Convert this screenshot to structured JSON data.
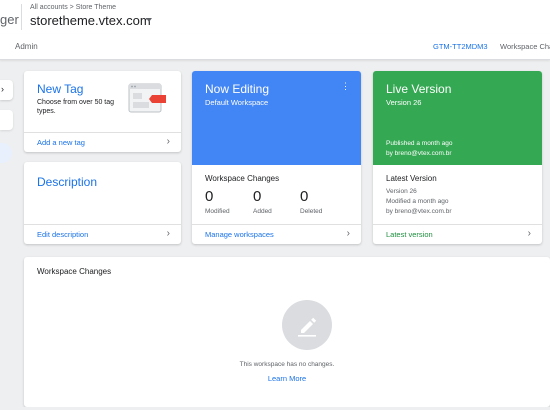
{
  "header": {
    "app_fragment": "ger",
    "breadcrumb": "All accounts > Store Theme",
    "container_name": "storetheme.vtex.com"
  },
  "nav": {
    "admin": "Admin",
    "container_id": "GTM-TT2MDM3",
    "workspace_changes": "Workspace Changes"
  },
  "new_tag": {
    "title": "New Tag",
    "description": "Choose from over 50 tag types.",
    "link": "Add a new tag"
  },
  "description_card": {
    "title": "Description",
    "link": "Edit description"
  },
  "now_editing": {
    "title": "Now Editing",
    "workspace": "Default Workspace",
    "changes_label": "Workspace Changes",
    "stats": [
      {
        "value": "0",
        "label": "Modified"
      },
      {
        "value": "0",
        "label": "Added"
      },
      {
        "value": "0",
        "label": "Deleted"
      }
    ],
    "link": "Manage workspaces"
  },
  "live_version": {
    "title": "Live Version",
    "version": "Version 26",
    "published": "Published a month ago",
    "published_by": "by breno@vtex.com.br",
    "latest_label": "Latest Version",
    "latest_version": "Version 26",
    "latest_modified": "Modified a month ago",
    "latest_by": "by breno@vtex.com.br",
    "link": "Latest version"
  },
  "changes_panel": {
    "title": "Workspace Changes",
    "empty_text": "This workspace has no changes.",
    "learn_more": "Learn More"
  },
  "colors": {
    "accent": "#1a73e8",
    "editing": "#4285f4",
    "live": "#34a853",
    "tag_red": "#ea4335"
  },
  "icons": {
    "caret": "chevron-down-icon",
    "card_chevron": "chevron-right-icon",
    "more": "more-vert-icon",
    "empty_state": "pencil-icon"
  }
}
